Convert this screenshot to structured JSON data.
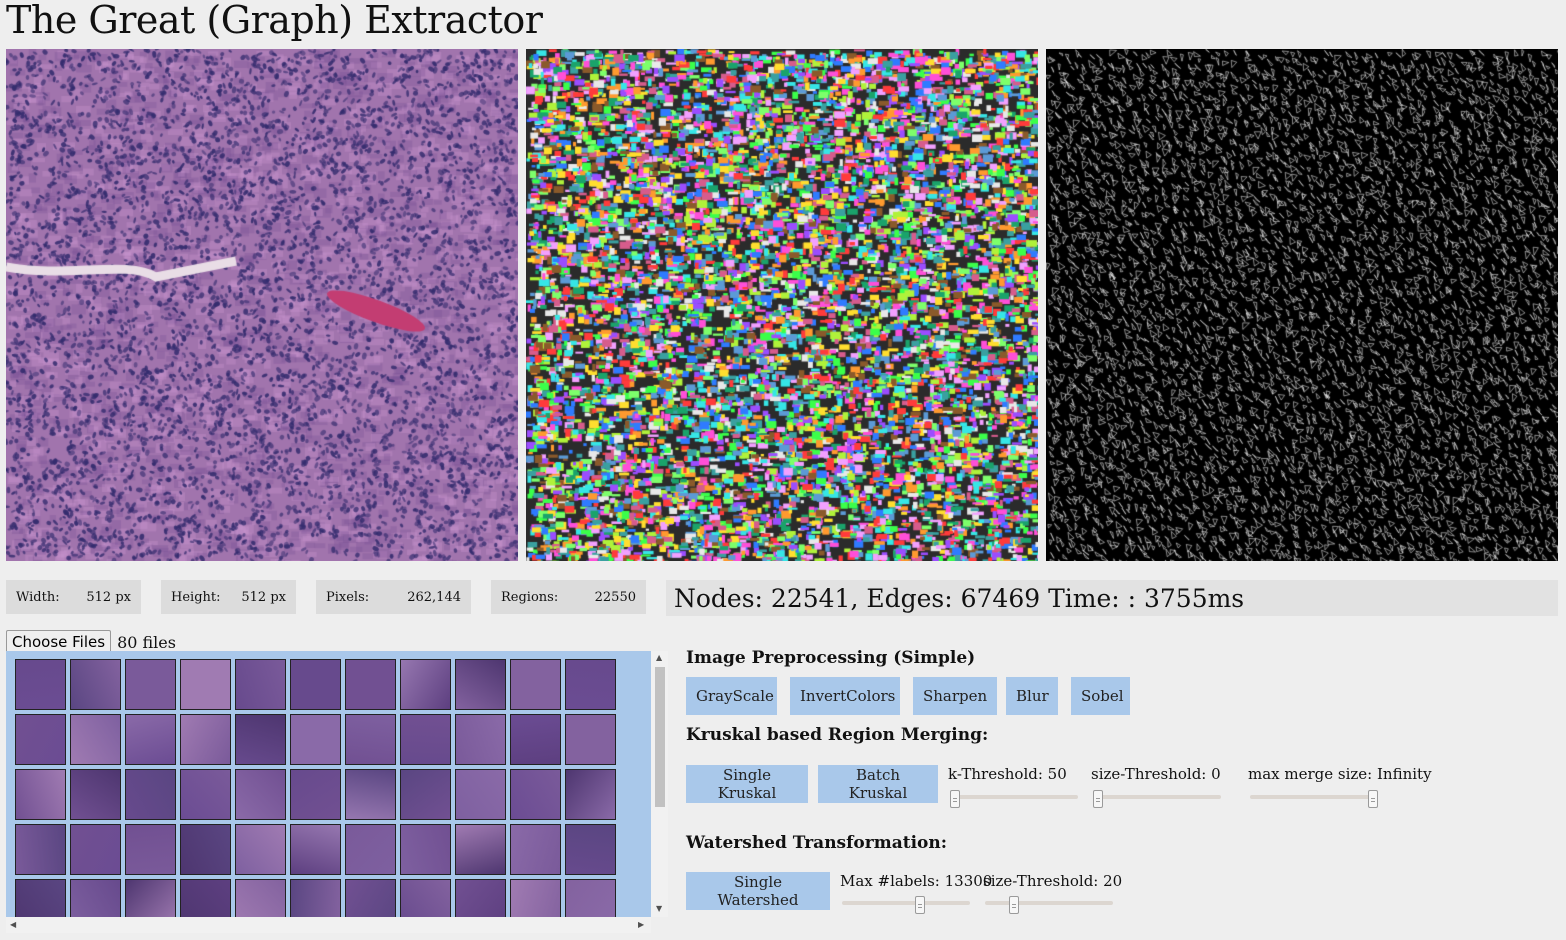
{
  "app": {
    "title": "The Great (Graph) Extractor"
  },
  "stats": {
    "width_label": "Width:",
    "width_value": "512 px",
    "height_label": "Height:",
    "height_value": "512 px",
    "pixels_label": "Pixels:",
    "pixels_value": "262,144",
    "regions_label": "Regions:",
    "regions_value": "22550"
  },
  "graph_stats": "Nodes: 22541, Edges: 67469 Time: : 3755ms",
  "files": {
    "button_label": "Choose Files",
    "count": "80 files"
  },
  "preprocessing": {
    "title": "Image Preprocessing (Simple)",
    "buttons": [
      "GrayScale",
      "InvertColors",
      "Sharpen",
      "Blur",
      "Sobel"
    ]
  },
  "kruskal": {
    "title": "Kruskal based Region Merging:",
    "single_label": "Single Kruskal",
    "batch_label": "Batch Kruskal",
    "k_threshold_label": "k-Threshold: 50",
    "size_threshold_label": "size-Threshold: 0",
    "max_merge_label": "max merge size: Infinity",
    "k_threshold_level": 0.0,
    "size_threshold_level": 0.0,
    "max_merge_level": 1.0
  },
  "watershed": {
    "title": "Watershed Transformation:",
    "single_label": "Single Watershed",
    "max_labels_label": "Max #labels: 13300",
    "size_threshold_label": "size-Threshold: 20",
    "max_labels_level": 0.62,
    "size_threshold_level": 0.2
  },
  "colors": {
    "accent": "#a9c8ea",
    "background": "#eeeeee",
    "stat_box": "#dcdcdc",
    "tissue": "#9a6aa8",
    "nuclei": "#3a3370"
  }
}
